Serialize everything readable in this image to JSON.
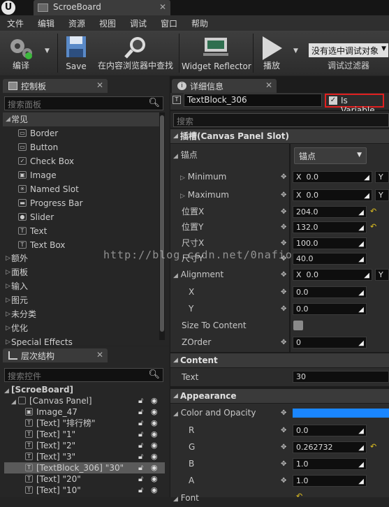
{
  "window": {
    "tab_title": "ScroeBoard"
  },
  "menu": [
    "文件",
    "编辑",
    "资源",
    "视图",
    "调试",
    "窗口",
    "帮助"
  ],
  "toolbar": {
    "compile": "编译",
    "save": "Save",
    "find": "在内容浏览器中查找",
    "widget_reflector": "Widget Reflector",
    "play": "播放",
    "debug_object": "没有选中调试对象",
    "debug_filter": "调试过滤器"
  },
  "palette": {
    "tab": "控制板",
    "search_placeholder": "搜索面板",
    "common": "常见",
    "items": [
      {
        "label": "Border",
        "glyph": "▭"
      },
      {
        "label": "Button",
        "glyph": "▭"
      },
      {
        "label": "Check Box",
        "glyph": "✓"
      },
      {
        "label": "Image",
        "glyph": "▣"
      },
      {
        "label": "Named Slot",
        "glyph": "✳"
      },
      {
        "label": "Progress Bar",
        "glyph": "▬"
      },
      {
        "label": "Slider",
        "glyph": "●"
      },
      {
        "label": "Text",
        "glyph": "T"
      },
      {
        "label": "Text Box",
        "glyph": "T"
      }
    ],
    "categories": [
      "额外",
      "面板",
      "输入",
      "图元",
      "未分类",
      "优化",
      "Special Effects"
    ]
  },
  "hierarchy": {
    "tab": "层次结构",
    "search_placeholder": "搜索控件",
    "root": "[ScroeBoard]",
    "canvas": "[Canvas Panel]",
    "rows": [
      {
        "label": "Image_47",
        "glyph": "▣",
        "selected": false
      },
      {
        "label": "[Text] \"排行榜\"",
        "glyph": "T",
        "selected": false
      },
      {
        "label": "[Text] \"1\"",
        "glyph": "T",
        "selected": false
      },
      {
        "label": "[Text] \"2\"",
        "glyph": "T",
        "selected": false
      },
      {
        "label": "[Text] \"3\"",
        "glyph": "T",
        "selected": false
      },
      {
        "label": "[TextBlock_306] \"30\"",
        "glyph": "T",
        "selected": true
      },
      {
        "label": "[Text] \"20\"",
        "glyph": "T",
        "selected": false
      },
      {
        "label": "[Text] \"10\"",
        "glyph": "T",
        "selected": false
      }
    ]
  },
  "details": {
    "tab": "详细信息",
    "name": "TextBlock_306",
    "is_variable": "Is Variable",
    "search_placeholder": "搜索",
    "slot_section": "插槽(Canvas Panel Slot)",
    "anchors_label": "锚点",
    "anchors_value": "锚点",
    "minimum": "Minimum",
    "maximum": "Maximum",
    "min_x": "0.0",
    "max_x": "0.0",
    "pos_x_label": "位置X",
    "pos_x": "204.0",
    "pos_y_label": "位置Y",
    "pos_y": "132.0",
    "size_x_label": "尺寸X",
    "size_x": "100.0",
    "size_y_label": "尺寸Y",
    "size_y": "40.0",
    "alignment": "Alignment",
    "align_x": "0.0",
    "x_label": "X",
    "x_val": "0.0",
    "y_label": "Y",
    "y_val": "0.0",
    "size_to_content": "Size To Content",
    "zorder": "ZOrder",
    "zorder_val": "0",
    "content_section": "Content",
    "text_label": "Text",
    "text_val": "30",
    "appearance_section": "Appearance",
    "color_opacity": "Color and Opacity",
    "r_label": "R",
    "r_val": "0.0",
    "g_label": "G",
    "g_val": "0.262732",
    "b_label": "B",
    "b_val": "1.0",
    "a_label": "A",
    "a_val": "1.0",
    "font": "Font",
    "x_prefix": "X",
    "y_prefix": "Y"
  },
  "watermark": "http://blog.csdn.net/0nafio",
  "colors": {
    "accent": "#1a86ff",
    "highlight": "#e02020"
  }
}
